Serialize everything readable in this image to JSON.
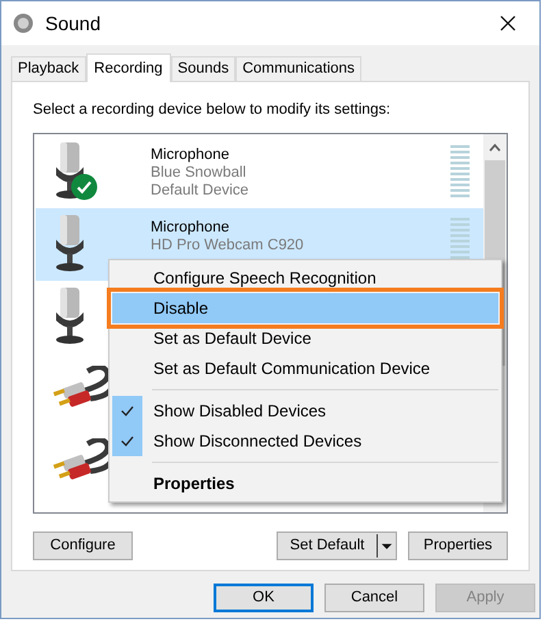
{
  "window": {
    "title": "Sound"
  },
  "tabs": [
    {
      "label": "Playback",
      "selected": false
    },
    {
      "label": "Recording",
      "selected": true
    },
    {
      "label": "Sounds",
      "selected": false
    },
    {
      "label": "Communications",
      "selected": false
    }
  ],
  "instruction": "Select a recording device below to modify its settings:",
  "devices": [
    {
      "kind": "microphone",
      "name": "Microphone",
      "detail": "Blue Snowball",
      "status": "Default Device",
      "selected": false,
      "default": true,
      "level": 0
    },
    {
      "kind": "microphone",
      "name": "Microphone",
      "detail": "HD Pro Webcam C920",
      "selected": true,
      "default": false,
      "level": 0
    },
    {
      "kind": "microphone",
      "selected": false,
      "default": false
    },
    {
      "kind": "line",
      "selected": false,
      "default": false
    },
    {
      "kind": "line",
      "selected": false,
      "default": false
    }
  ],
  "context_menu": [
    {
      "kind": "item",
      "label": "Configure Speech Recognition",
      "selected": false,
      "checked": false,
      "bold": false
    },
    {
      "kind": "item",
      "label": "Disable",
      "selected": true,
      "checked": false,
      "bold": false
    },
    {
      "kind": "item",
      "label": "Set as Default Device",
      "selected": false,
      "checked": false,
      "bold": false
    },
    {
      "kind": "item",
      "label": "Set as Default Communication Device",
      "selected": false,
      "checked": false,
      "bold": false
    },
    {
      "kind": "separator"
    },
    {
      "kind": "item",
      "label": "Show Disabled Devices",
      "selected": false,
      "checked": true,
      "bold": false
    },
    {
      "kind": "item",
      "label": "Show Disconnected Devices",
      "selected": false,
      "checked": true,
      "bold": false
    },
    {
      "kind": "separator"
    },
    {
      "kind": "item",
      "label": "Properties",
      "selected": false,
      "checked": false,
      "bold": true
    }
  ],
  "panel_buttons": {
    "configure": "Configure",
    "set_default": "Set Default",
    "properties": "Properties"
  },
  "dialog_buttons": [
    {
      "label": "OK",
      "default": true,
      "disabled": false
    },
    {
      "label": "Cancel",
      "default": false,
      "disabled": false
    },
    {
      "label": "Apply",
      "default": false,
      "disabled": true
    }
  ]
}
